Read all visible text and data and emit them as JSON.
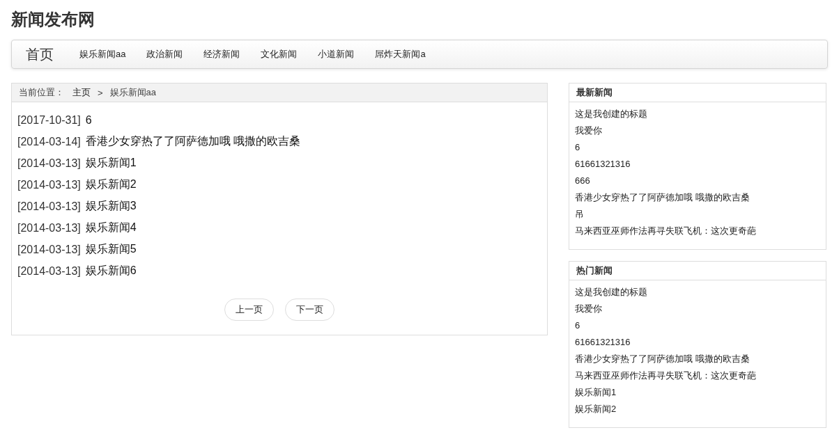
{
  "site_title": "新闻发布网",
  "nav": {
    "brand": "首页",
    "items": [
      {
        "label": "娱乐新闻aa"
      },
      {
        "label": "政治新闻"
      },
      {
        "label": "经济新闻"
      },
      {
        "label": "文化新闻"
      },
      {
        "label": "小道新闻"
      },
      {
        "label": "屌炸天新闻a"
      }
    ]
  },
  "breadcrumb": {
    "label": "当前位置：",
    "home": "主页",
    "separator": ">",
    "current": "娱乐新闻aa"
  },
  "news_list": [
    {
      "date": "[2017-10-31]",
      "title": "6"
    },
    {
      "date": "[2014-03-14]",
      "title": "香港少女穿热了了阿萨德加哦 哦撒的欧吉桑"
    },
    {
      "date": "[2014-03-13]",
      "title": "娱乐新闻1"
    },
    {
      "date": "[2014-03-13]",
      "title": "娱乐新闻2"
    },
    {
      "date": "[2014-03-13]",
      "title": "娱乐新闻3"
    },
    {
      "date": "[2014-03-13]",
      "title": "娱乐新闻4"
    },
    {
      "date": "[2014-03-13]",
      "title": "娱乐新闻5"
    },
    {
      "date": "[2014-03-13]",
      "title": "娱乐新闻6"
    }
  ],
  "pagination": {
    "prev": "上一页",
    "next": "下一页"
  },
  "sidebar": [
    {
      "title": "最新新闻",
      "items": [
        "这是我创建的标题",
        "我爱你",
        "6",
        "61661321316",
        "666",
        "香港少女穿热了了阿萨德加哦 哦撒的欧吉桑",
        "吊",
        "马来西亚巫师作法再寻失联飞机：这次更奇葩"
      ]
    },
    {
      "title": "热门新闻",
      "items": [
        "这是我创建的标题",
        "我爱你",
        "6",
        "61661321316",
        "香港少女穿热了了阿萨德加哦 哦撒的欧吉桑",
        "马来西亚巫师作法再寻失联飞机：这次更奇葩",
        "娱乐新闻1",
        "娱乐新闻2"
      ]
    }
  ]
}
